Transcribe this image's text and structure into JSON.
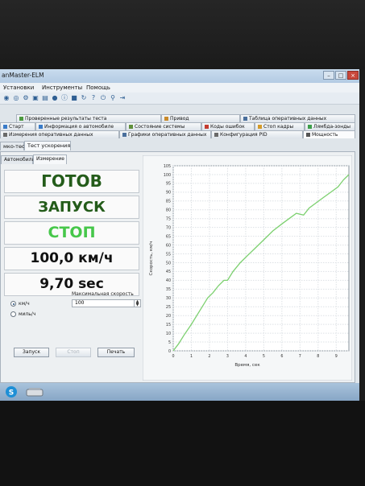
{
  "window": {
    "title": "anMaster-ELM",
    "controls": {
      "minimize": "–",
      "maximize": "□",
      "close": "×"
    }
  },
  "menu": [
    "Установки",
    "Инструменты",
    "Помощь"
  ],
  "tabs_row1": [
    {
      "label": "Проверенные результаты теста",
      "icon": "check-icon"
    },
    {
      "label": "Привод",
      "icon": "drive-icon"
    },
    {
      "label": "Таблица оперативных данных",
      "icon": "table-icon"
    }
  ],
  "tabs_row2": [
    {
      "label": "Старт",
      "icon": "start-icon"
    },
    {
      "label": "Информация о автомобиле",
      "icon": "info-icon"
    },
    {
      "label": "Состояние системы",
      "icon": "system-icon"
    },
    {
      "label": "Коды ошибок",
      "icon": "error-codes-icon"
    },
    {
      "label": "Стоп кадры",
      "icon": "freeze-frame-icon"
    },
    {
      "label": "Лямбда-зонды",
      "icon": "lambda-icon"
    }
  ],
  "tabs_row3": [
    {
      "label": "Измерения оперативных данных",
      "icon": "measure-icon"
    },
    {
      "label": "Графики оперативных данных",
      "icon": "graph-icon"
    },
    {
      "label": "Конфигурация PID",
      "icon": "pid-icon"
    },
    {
      "label": "Мощность",
      "icon": "power-icon"
    }
  ],
  "subtabs": [
    "мко-тест",
    "Тест ускорения"
  ],
  "innertabs": [
    "Автомобиль",
    "Измерение"
  ],
  "status": {
    "ready": "ГОТОВ",
    "launch": "ЗАПУСК",
    "stop": "СТОП",
    "speed": "100,0 км/ч",
    "time": "9,70 sec"
  },
  "colors": {
    "ready": "#245c1a",
    "launch": "#245c1a",
    "stop": "#46c74a",
    "value": "#111111",
    "curve": "#7cd06f"
  },
  "units": {
    "kmh": "км/ч",
    "mph": "миль/ч",
    "selected": "kmh",
    "max_speed_label": "Максимальная скорость",
    "max_speed_value": "100"
  },
  "buttons": {
    "start": "Запуск",
    "stop": "Стоп",
    "print": "Печать"
  },
  "chart_data": {
    "type": "line",
    "xlabel": "Время, сек",
    "ylabel": "Скорость, км/ч",
    "xlim": [
      0,
      9.7
    ],
    "ylim": [
      0,
      105
    ],
    "xticks": [
      0,
      1,
      2,
      3,
      4,
      5,
      6,
      7,
      8,
      9
    ],
    "yticks": [
      0,
      5,
      10,
      15,
      20,
      25,
      30,
      35,
      40,
      45,
      50,
      55,
      60,
      65,
      70,
      75,
      80,
      85,
      90,
      95,
      100,
      105
    ],
    "grid": true,
    "x": [
      0,
      0.3,
      0.6,
      1.0,
      1.3,
      1.6,
      1.9,
      2.2,
      2.5,
      2.8,
      3.0,
      3.3,
      3.7,
      4.1,
      4.5,
      5.0,
      5.5,
      6.0,
      6.4,
      6.8,
      7.2,
      7.5,
      7.9,
      8.3,
      8.7,
      9.1,
      9.4,
      9.7
    ],
    "y": [
      0,
      4,
      9,
      15,
      20,
      25,
      30,
      33,
      37,
      40,
      40,
      45,
      50,
      54,
      58,
      63,
      68,
      72,
      75,
      78,
      77,
      81,
      84,
      87,
      90,
      93,
      97,
      100
    ]
  },
  "taskbar": {
    "apps": [
      "skype-icon",
      "scanner-icon"
    ]
  }
}
